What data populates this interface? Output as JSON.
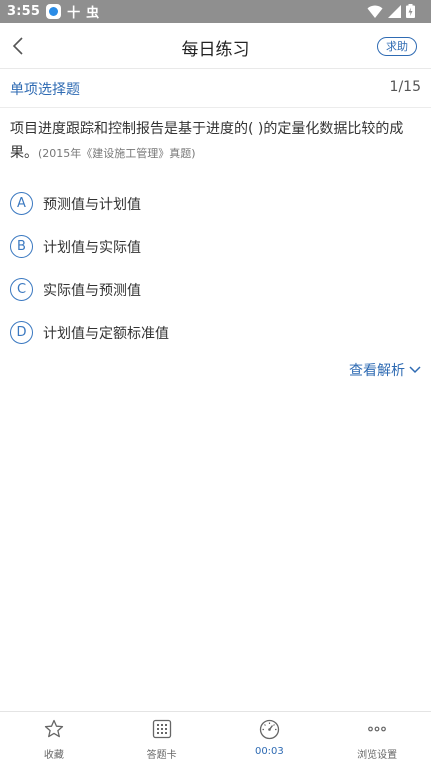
{
  "status_bar": {
    "time": "3:55",
    "app_glyph_1": "十",
    "app_glyph_2": "虫"
  },
  "header": {
    "title": "每日练习",
    "help_label": "求助"
  },
  "question_header": {
    "type": "单项选择题",
    "progress": "1/15"
  },
  "question": {
    "text": "项目进度跟踪和控制报告是基于进度的( )的定量化数据比较的成果。",
    "source": "(2015年《建设施工管理》真题)"
  },
  "options": [
    {
      "letter": "A",
      "text": "预测值与计划值"
    },
    {
      "letter": "B",
      "text": "计划值与实际值"
    },
    {
      "letter": "C",
      "text": "实际值与预测值"
    },
    {
      "letter": "D",
      "text": "计划值与定额标准值"
    }
  ],
  "analysis_label": "查看解析",
  "bottom_nav": [
    {
      "label": "收藏",
      "icon": "star-icon"
    },
    {
      "label": "答题卡",
      "icon": "grid-icon"
    },
    {
      "label": "00:03",
      "icon": "timer-icon"
    },
    {
      "label": "浏览设置",
      "icon": "more-icon"
    }
  ],
  "colors": {
    "accent": "#2f6bb3",
    "status_bar": "#8f8f8f"
  }
}
